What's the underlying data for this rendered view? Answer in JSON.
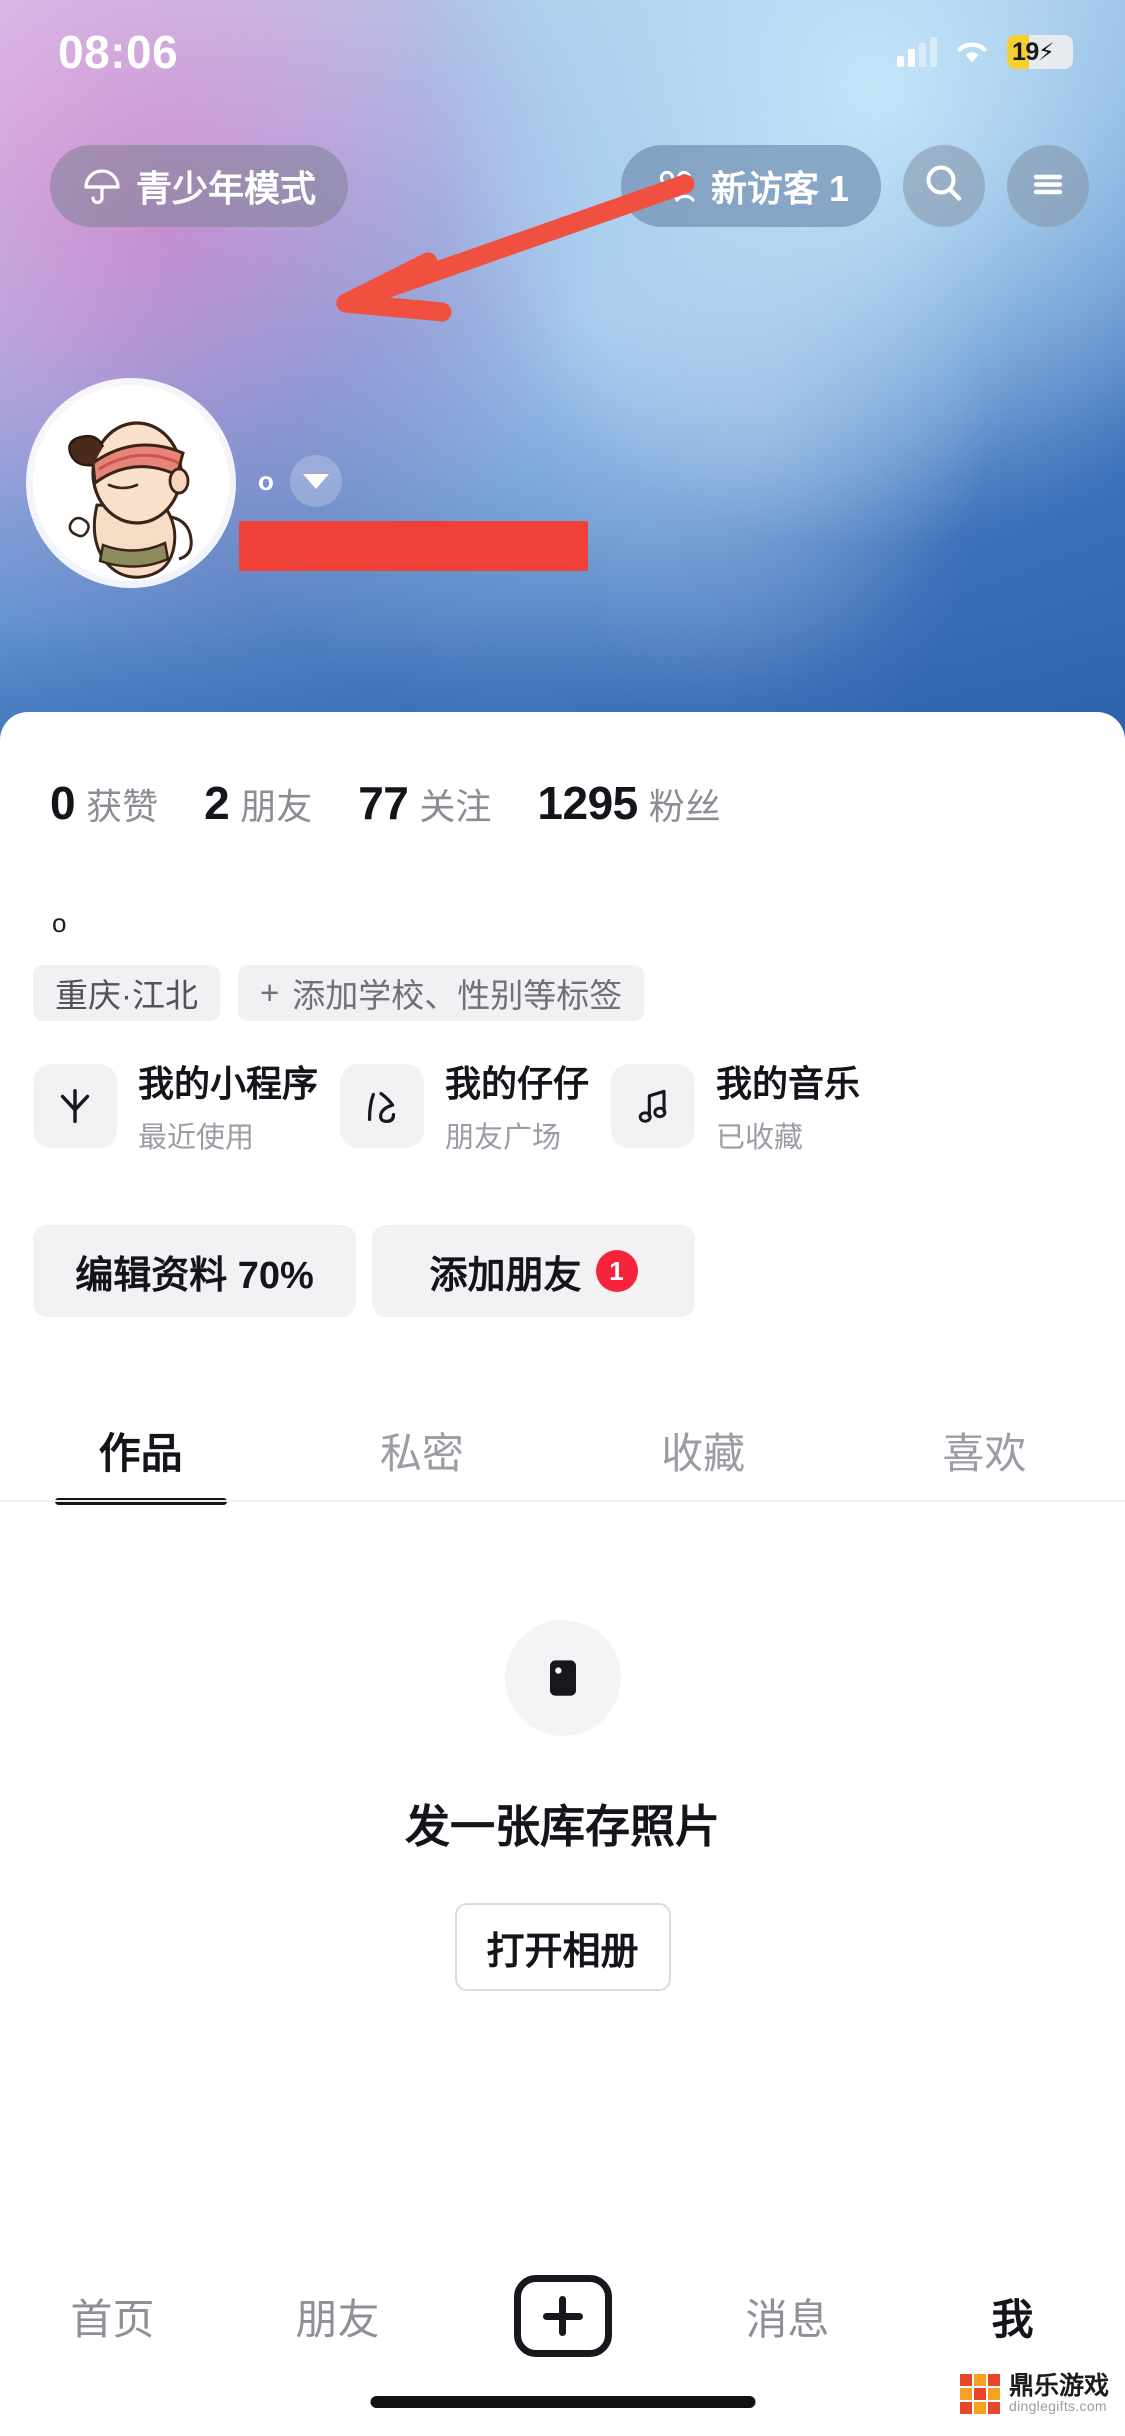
{
  "status_bar": {
    "time": "08:06",
    "moon_icon": "moon-icon",
    "signal_icon": "cellular-signal-icon",
    "wifi_icon": "wifi-icon",
    "battery_percent": "19",
    "battery_charging_icon": "lightning-bolt-icon"
  },
  "header": {
    "teen_mode_label": "青少年模式",
    "teen_mode_icon": "umbrella-icon",
    "visitors_label": "新访客 1",
    "visitors_icon": "people-icon",
    "search_icon": "search-icon",
    "menu_icon": "hamburger-menu-icon"
  },
  "profile": {
    "avatar_icon": "cartoon-avatar",
    "name_dot": "o",
    "dropdown_icon": "chevron-down-icon",
    "name_redacted": "",
    "bio": "o"
  },
  "stats": [
    {
      "num": "0",
      "label": "获赞"
    },
    {
      "num": "2",
      "label": "朋友"
    },
    {
      "num": "77",
      "label": "关注"
    },
    {
      "num": "1295",
      "label": "粉丝"
    }
  ],
  "tags": {
    "location": "重庆·江北",
    "add_plus": "+",
    "add_label": "添加学校、性别等标签"
  },
  "cards": [
    {
      "icon": "asterisk-icon",
      "title": "我的小程序",
      "subtitle": "最近使用"
    },
    {
      "icon": "zaizai-icon",
      "title": "我的仔仔",
      "subtitle": "朋友广场"
    },
    {
      "icon": "music-note-icon",
      "title": "我的音乐",
      "subtitle": "已收藏"
    }
  ],
  "actions": {
    "edit_profile": "编辑资料 70%",
    "add_friend": "添加朋友",
    "add_friend_badge": "1"
  },
  "tabs": [
    {
      "label": "作品",
      "active": true
    },
    {
      "label": "私密",
      "active": false
    },
    {
      "label": "收藏",
      "active": false
    },
    {
      "label": "喜欢",
      "active": false
    }
  ],
  "empty_state": {
    "icon": "image-placeholder-icon",
    "title": "发一张库存照片",
    "button": "打开相册"
  },
  "bottom_nav": [
    {
      "label": "首页",
      "active": false
    },
    {
      "label": "朋友",
      "active": false
    },
    {
      "label": "+",
      "active": false
    },
    {
      "label": "消息",
      "active": false
    },
    {
      "label": "我",
      "active": true
    }
  ],
  "watermark": {
    "title": "鼎乐游戏",
    "url": "dinglegifts.com"
  },
  "colors": {
    "accent_red": "#ef4137",
    "badge_red": "#f5243c",
    "text_primary": "#14151a",
    "text_secondary": "#8a8d94",
    "chip_bg": "#f1f1f3",
    "battery_yellow": "#f5cf2e"
  }
}
